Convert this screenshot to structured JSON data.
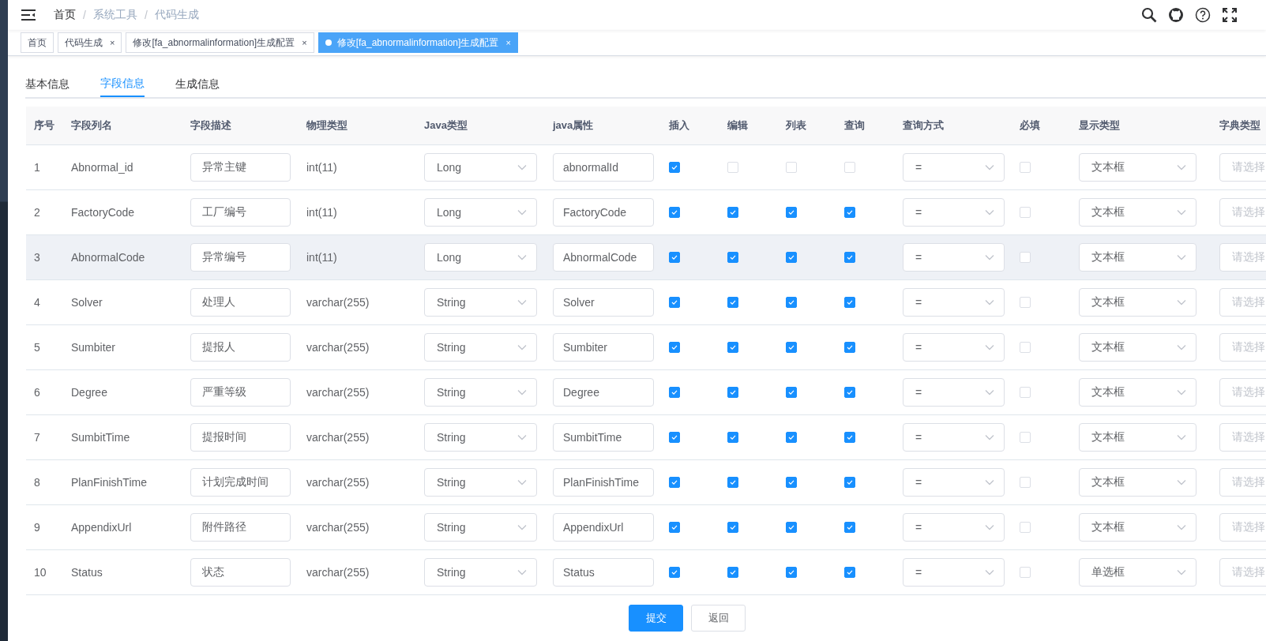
{
  "breadcrumb": [
    "首页",
    "系统工具",
    "代码生成"
  ],
  "breadcrumb_separator": "/",
  "tags": [
    {
      "label": "首页",
      "selected": false
    },
    {
      "label": "代码生成",
      "selected": false,
      "close": "×"
    },
    {
      "label": "修改[fa_abnormalinformation]生成配置",
      "selected": false,
      "close": "×"
    },
    {
      "label": "修改[fa_abnormalinformation]生成配置",
      "selected": true,
      "close": "×"
    }
  ],
  "tabs": [
    {
      "label": "基本信息",
      "selected": false
    },
    {
      "label": "字段信息",
      "selected": true
    },
    {
      "label": "生成信息",
      "selected": false
    }
  ],
  "table": {
    "columns": [
      "序号",
      "字段列名",
      "字段描述",
      "物理类型",
      "Java类型",
      "java属性",
      "插入",
      "编辑",
      "列表",
      "查询",
      "查询方式",
      "必填",
      "显示类型",
      "字典类型"
    ],
    "rows": [
      {
        "index": "1",
        "column_name": "Abnormal_id",
        "description": "异常主键",
        "physical_type": "int(11)",
        "java_type": "Long",
        "java_field": "abnormalId",
        "insert": true,
        "edit": false,
        "list": false,
        "query": false,
        "query_type": "=",
        "required": false,
        "html_type": "文本框",
        "dict_placeholder": "请选择",
        "hovered": false
      },
      {
        "index": "2",
        "column_name": "FactoryCode",
        "description": "工厂编号",
        "physical_type": "int(11)",
        "java_type": "Long",
        "java_field": "FactoryCode",
        "insert": true,
        "edit": true,
        "list": true,
        "query": true,
        "query_type": "=",
        "required": false,
        "html_type": "文本框",
        "dict_placeholder": "请选择",
        "hovered": false
      },
      {
        "index": "3",
        "column_name": "AbnormalCode",
        "description": "异常编号",
        "physical_type": "int(11)",
        "java_type": "Long",
        "java_field": "AbnormalCode",
        "insert": true,
        "edit": true,
        "list": true,
        "query": true,
        "query_type": "=",
        "required": false,
        "html_type": "文本框",
        "dict_placeholder": "请选择",
        "hovered": true
      },
      {
        "index": "4",
        "column_name": "Solver",
        "description": "处理人",
        "physical_type": "varchar(255)",
        "java_type": "String",
        "java_field": "Solver",
        "insert": true,
        "edit": true,
        "list": true,
        "query": true,
        "query_type": "=",
        "required": false,
        "html_type": "文本框",
        "dict_placeholder": "请选择",
        "hovered": false
      },
      {
        "index": "5",
        "column_name": "Sumbiter",
        "description": "提报人",
        "physical_type": "varchar(255)",
        "java_type": "String",
        "java_field": "Sumbiter",
        "insert": true,
        "edit": true,
        "list": true,
        "query": true,
        "query_type": "=",
        "required": false,
        "html_type": "文本框",
        "dict_placeholder": "请选择",
        "hovered": false
      },
      {
        "index": "6",
        "column_name": "Degree",
        "description": "严重等级",
        "physical_type": "varchar(255)",
        "java_type": "String",
        "java_field": "Degree",
        "insert": true,
        "edit": true,
        "list": true,
        "query": true,
        "query_type": "=",
        "required": false,
        "html_type": "文本框",
        "dict_placeholder": "请选择",
        "hovered": false
      },
      {
        "index": "7",
        "column_name": "SumbitTime",
        "description": "提报时间",
        "physical_type": "varchar(255)",
        "java_type": "String",
        "java_field": "SumbitTime",
        "insert": true,
        "edit": true,
        "list": true,
        "query": true,
        "query_type": "=",
        "required": false,
        "html_type": "文本框",
        "dict_placeholder": "请选择",
        "hovered": false
      },
      {
        "index": "8",
        "column_name": "PlanFinishTime",
        "description": "计划完成时间",
        "physical_type": "varchar(255)",
        "java_type": "String",
        "java_field": "PlanFinishTime",
        "insert": true,
        "edit": true,
        "list": true,
        "query": true,
        "query_type": "=",
        "required": false,
        "html_type": "文本框",
        "dict_placeholder": "请选择",
        "hovered": false
      },
      {
        "index": "9",
        "column_name": "AppendixUrl",
        "description": "附件路径",
        "physical_type": "varchar(255)",
        "java_type": "String",
        "java_field": "AppendixUrl",
        "insert": true,
        "edit": true,
        "list": true,
        "query": true,
        "query_type": "=",
        "required": false,
        "html_type": "文本框",
        "dict_placeholder": "请选择",
        "hovered": false
      },
      {
        "index": "10",
        "column_name": "Status",
        "description": "状态",
        "physical_type": "varchar(255)",
        "java_type": "String",
        "java_field": "Status",
        "insert": true,
        "edit": true,
        "list": true,
        "query": true,
        "query_type": "=",
        "required": false,
        "html_type": "单选框",
        "dict_placeholder": "请选择",
        "hovered": false
      }
    ]
  },
  "buttons": [
    {
      "label": "提交",
      "kind": "primary"
    },
    {
      "label": "返回",
      "kind": "default"
    }
  ]
}
